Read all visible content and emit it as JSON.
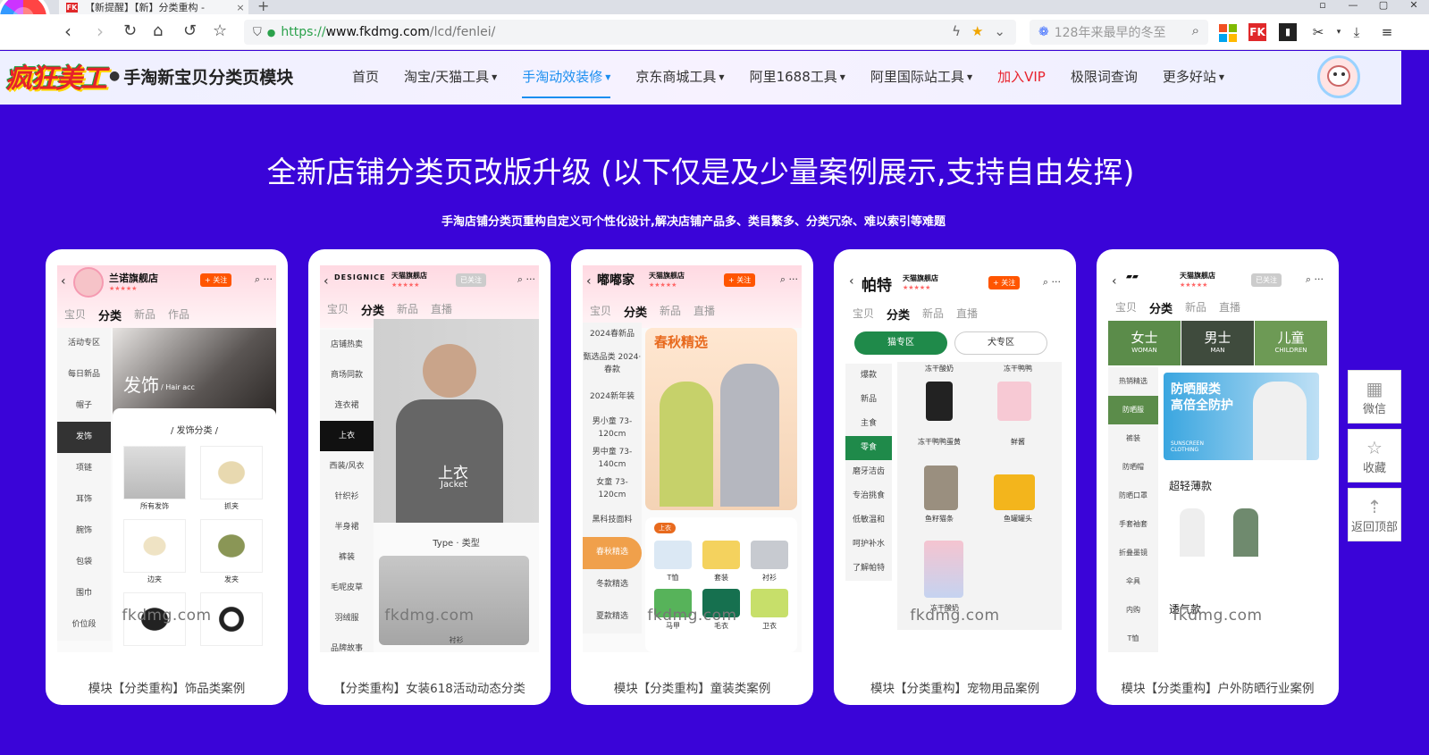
{
  "browser": {
    "tab_title": "【新提醒】【新】分类重构 -",
    "tab_close": "×",
    "new_tab": "+",
    "url_protocol": "https://",
    "url_host": "www.fkdmg.com",
    "url_path": "/lcd/fenlei/",
    "search_placeholder": "128年来最早的冬至",
    "fk_label": "FK"
  },
  "site": {
    "brand_logo": "疯狂美工",
    "brand_name": "手淘新宝贝分类页模块",
    "menu": [
      {
        "label": "首页",
        "dropdown": false
      },
      {
        "label": "淘宝/天猫工具",
        "dropdown": true
      },
      {
        "label": "手淘动效装修",
        "dropdown": true,
        "active": true
      },
      {
        "label": "京东商城工具",
        "dropdown": true
      },
      {
        "label": "阿里1688工具",
        "dropdown": true
      },
      {
        "label": "阿里国际站工具",
        "dropdown": true
      },
      {
        "label": "加入VIP",
        "dropdown": false,
        "highlight": true
      },
      {
        "label": "极限词查询",
        "dropdown": false
      },
      {
        "label": "更多好站",
        "dropdown": true
      }
    ]
  },
  "main": {
    "headline": "全新店铺分类页改版升级 (以下仅是及少量案例展示,支持自由发挥)",
    "subline": "手淘店铺分类页重构自定义可个性化设计,解决店铺产品多、类目繁多、分类冗杂、难以索引等难题",
    "watermark": "fkdmg.com",
    "cards": [
      {
        "caption": "模块【分类重构】饰品类案例",
        "shop": "兰诺旗舰店",
        "follow": "+ 关注",
        "tabs": [
          "宝贝",
          "分类",
          "新品",
          "作品"
        ],
        "side": [
          "活动专区",
          "每日新品",
          "帽子",
          "发饰",
          "项链",
          "耳饰",
          "腕饰",
          "包袋",
          "围巾",
          "价位段"
        ],
        "side_active": 3,
        "banner": "发饰",
        "banner_en": "/ Hair acc",
        "panel_title": "/ 发饰分类 /",
        "items": [
          "所有发饰",
          "抓夹",
          "边夹",
          "发夹"
        ]
      },
      {
        "caption": "【分类重构】女装618活动动态分类",
        "shop": "天猫旗舰店",
        "brand": "DESIGNICE",
        "follow": "已关注",
        "tabs": [
          "宝贝",
          "分类",
          "新品",
          "直播"
        ],
        "side": [
          "店铺热卖",
          "商场同款",
          "连衣裙",
          "上衣",
          "西装/风衣",
          "针织衫",
          "半身裙",
          "裤装",
          "毛呢皮草",
          "羽绒服",
          "品牌故事"
        ],
        "side_active": 3,
        "banner": "上衣",
        "banner_en": "Jacket",
        "type_label": "Type · 类型",
        "item": "衬衫"
      },
      {
        "caption": "模块【分类重构】童装类案例",
        "shop": "天猫旗舰店",
        "brand": "嘟嘟家",
        "follow": "+ 关注",
        "tabs": [
          "宝贝",
          "分类",
          "新品",
          "直播"
        ],
        "side": [
          "2024春新品",
          "甄选品类 2024·春款",
          "2024新年装",
          "男小童 73-120cm",
          "男中童 73-140cm",
          "女童 73-120cm",
          "黑科技面料",
          "春秋精选",
          "冬款精选",
          "夏款精选"
        ],
        "side_active": 7,
        "banner": "春秋精选",
        "tag": "上衣",
        "items": [
          "T恤",
          "套装",
          "衬衫",
          "马甲",
          "毛衣",
          "卫衣"
        ]
      },
      {
        "caption": "模块【分类重构】宠物用品案例",
        "shop": "天猫旗舰店",
        "brand": "帕特",
        "follow": "+ 关注",
        "tabs": [
          "宝贝",
          "分类",
          "新品",
          "直播"
        ],
        "pills": [
          "猫专区",
          "犬专区"
        ],
        "side": [
          "爆款",
          "新品",
          "主食",
          "零食",
          "磨牙洁齿",
          "专治挑食",
          "低敏温和",
          "呵护补水",
          "了解帕特"
        ],
        "side_active": 3,
        "items": [
          "冻干酸奶",
          "冻干鸭鸭",
          "冻干鸭鸭蛋黄",
          "鲜酱",
          "鱼籽猫条",
          "鱼罐罐头",
          "冻干酸奶"
        ]
      },
      {
        "caption": "模块【分类重构】户外防晒行业案例",
        "shop": "天猫旗舰店",
        "follow": "已关注",
        "tabs": [
          "宝贝",
          "分类",
          "新品",
          "直播"
        ],
        "top_tiles": [
          {
            "cn": "女士",
            "en": "WOMAN"
          },
          {
            "cn": "男士",
            "en": "MAN"
          },
          {
            "cn": "儿童",
            "en": "CHILDREN"
          }
        ],
        "side": [
          "热销精选",
          "防晒服",
          "裤装",
          "防晒帽",
          "防晒口罩",
          "手套袖套",
          "折叠墨镜",
          "伞具",
          "内购",
          "T恤"
        ],
        "side_active": 1,
        "banner_l1": "防晒服类",
        "banner_l2": "高倍全防护",
        "banner_en": "SUNSCREEN CLOTHING",
        "section1": "超轻薄款",
        "section2": "透气款"
      }
    ]
  },
  "floats": [
    "微信",
    "收藏",
    "返回顶部"
  ],
  "colors": {
    "background": "#3a04d8",
    "accent": "#1a8ef0",
    "vip": "#e8232d"
  }
}
